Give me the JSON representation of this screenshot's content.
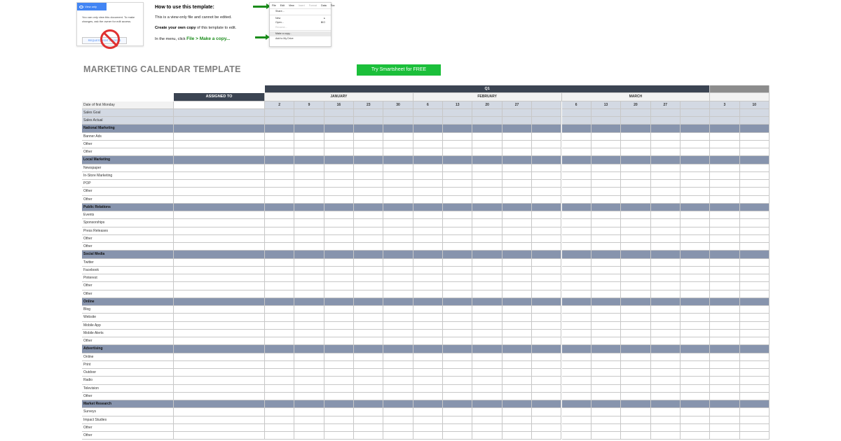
{
  "view_only_card": {
    "button_label": "View only",
    "message": "You can only view this document. To make changes, ask the owner for edit access.",
    "request_label": "REQUEST EDIT ACCESS"
  },
  "instructions": {
    "heading": "How to use this template:",
    "line1": "This is a view-only file and cannot be edited.",
    "line2_bold": "Create your own copy",
    "line2_rest": " of this template to edit.",
    "line3_prefix": "In the menu, click ",
    "line3_action": "File > Make a copy..."
  },
  "file_menu": {
    "menubar": [
      "File",
      "Edit",
      "View",
      "Insert",
      "Format",
      "Data",
      "Too"
    ],
    "items": [
      {
        "label": "Share...",
        "shortcut": "",
        "dim": false
      },
      {
        "label": "New",
        "shortcut": "▸",
        "dim": false
      },
      {
        "label": "Open...",
        "shortcut": "⌘O",
        "dim": false
      },
      {
        "label": "Rename...",
        "shortcut": "",
        "dim": true
      },
      {
        "label": "Make a copy...",
        "shortcut": "",
        "dim": false,
        "highlight": true
      },
      {
        "label": "Add to My Drive",
        "shortcut": "",
        "dim": false
      }
    ]
  },
  "title": "MARKETING CALENDAR TEMPLATE",
  "cta_label": "Try Smartsheet for FREE",
  "colors": {
    "dark_header": "#3b4452",
    "category_row": "#8794ad",
    "goal_row": "#d3d9e3",
    "cta": "#1bbf3a"
  },
  "grid": {
    "quarter_label": "Q1",
    "assigned_label": "ASSIGNED TO",
    "months": [
      "JANUARY",
      "FEBRUARY",
      "MARCH"
    ],
    "week_days": [
      "2",
      "9",
      "16",
      "23",
      "30",
      "6",
      "13",
      "20",
      "27",
      "",
      "6",
      "13",
      "20",
      "27",
      "",
      "3",
      "10"
    ],
    "summary_rows": [
      "Date of first Monday",
      "Sales Goal",
      "Sales Actual"
    ],
    "sections": [
      {
        "name": "National Marketing",
        "items": [
          "Banner Ads",
          "Other",
          "Other"
        ]
      },
      {
        "name": "Local Marketing",
        "items": [
          "Newspaper",
          "In-Store Marketing",
          "POP",
          "Other",
          "Other"
        ]
      },
      {
        "name": "Public Relations",
        "items": [
          "Events",
          "Sponsorships",
          "Press Releases",
          "Other",
          "Other"
        ]
      },
      {
        "name": "Social Media",
        "items": [
          "Twitter",
          "Facebook",
          "Pinterest",
          "Other",
          "Other"
        ]
      },
      {
        "name": "Online",
        "items": [
          "Blog",
          "Website",
          "Mobile App",
          "Mobile Alerts",
          "Other"
        ]
      },
      {
        "name": "Advertising",
        "items": [
          "Online",
          "Print",
          "Outdoor",
          "Radio",
          "Television",
          "Other"
        ]
      },
      {
        "name": "Market Research",
        "items": [
          "Surveys",
          "Impact Studies",
          "Other",
          "Other"
        ]
      }
    ]
  }
}
